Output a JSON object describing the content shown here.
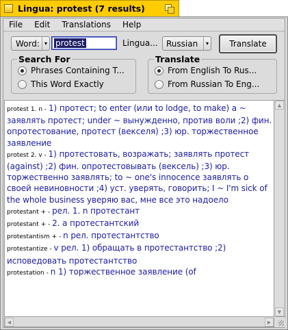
{
  "window": {
    "title": "Lingua: protest (7 results)"
  },
  "menu": [
    "File",
    "Edit",
    "Translations",
    "Help"
  ],
  "toolbar": {
    "mode_label": "Word:",
    "search_value": "protest",
    "language_label": "Lingua...",
    "language_value": "Russian",
    "translate_label": "Translate"
  },
  "search_for": {
    "legend": "Search For",
    "options": [
      {
        "label": "Phrases Containing T...",
        "selected": true
      },
      {
        "label": "This Word Exactly",
        "selected": false
      }
    ]
  },
  "translate_dir": {
    "legend": "Translate",
    "options": [
      {
        "label": "From English To Rus...",
        "selected": true
      },
      {
        "label": "From Russian To Eng...",
        "selected": false
      }
    ]
  },
  "results": [
    {
      "term": "protest 1. n - ",
      "definition": "1) протест; to enter (или to lodge, to make) a ~ заявлять протест; under ~ вынужденно, против воли ;2) фин. опротестование, протест (векселя) ;3) юр. торжественное заявление"
    },
    {
      "term": "protest 2. v - ",
      "definition": "1) протестовать, возражать; заявлять протест (against) ;2) фин. опротестовывать (вексель) ;3) юр. торжественно заявлять; to ~ one's innocence заявлять о своей невиновности ;4) уст. уверять, говорить; I ~ I'm sick of the whole business уверяю вас, мне все это надоело"
    },
    {
      "term": "protestant + - ",
      "definition": "  рел. 1. n протестант"
    },
    {
      "term": "protestant + - ",
      "definition": "2. a протестантский"
    },
    {
      "term": "protestantism + - ",
      "definition": "  n рел. протестантство"
    },
    {
      "term": "protestantize - ",
      "definition": "v рел. 1) обращать в протестантство ;2) исповедовать протестантство"
    },
    {
      "term": "protestation - ",
      "definition": "n 1) торжественное заявление (of"
    }
  ]
}
